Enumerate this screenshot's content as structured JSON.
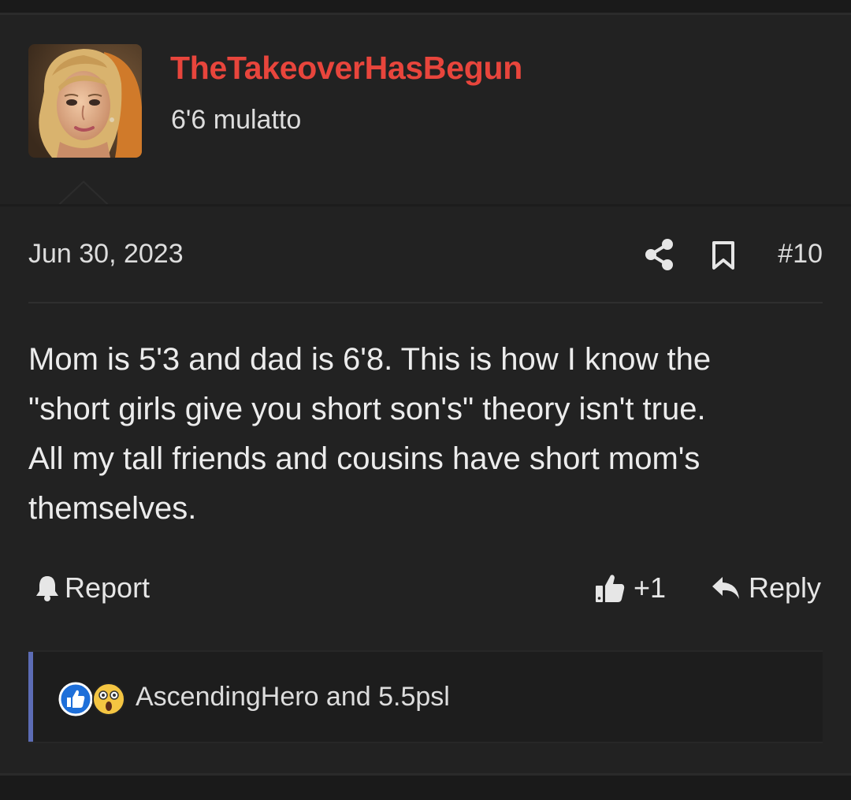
{
  "post": {
    "username": "TheTakeoverHasBegun",
    "user_title": "6'6 mulatto",
    "date": "Jun 30, 2023",
    "post_number": "#10",
    "body_lines": [
      "Mom is 5'3 and dad is 6'8. This is how I know the",
      "\"short girls give you short son's\" theory isn't true.",
      "All my tall friends and cousins have short mom's",
      "themselves."
    ]
  },
  "actions": {
    "report_label": "Report",
    "like_count": "+1",
    "reply_label": "Reply"
  },
  "reactions": {
    "text": "AscendingHero and 5.5psl",
    "icons": [
      "like-reaction-icon",
      "shocked-reaction-icon"
    ]
  },
  "colors": {
    "background": "#1a1a1a",
    "post_background": "#222222",
    "username": "#e8453c",
    "text": "#e6e6e6",
    "reaction_bar": "#5c6cb5"
  }
}
